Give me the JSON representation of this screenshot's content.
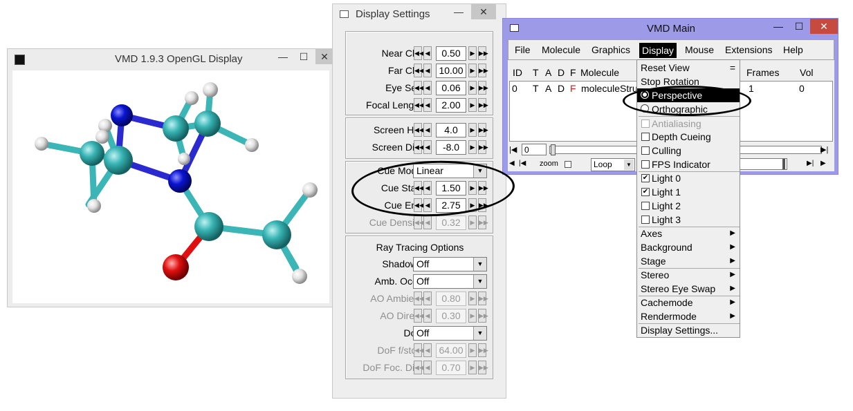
{
  "gl_window": {
    "title": "VMD 1.9.3 OpenGL Display",
    "app_icon": "vmd-app-icon",
    "controls": {
      "minimize": "—",
      "maximize": "☐",
      "close": "✕"
    }
  },
  "display_settings": {
    "title": "Display Settings",
    "controls": {
      "minimize": "—",
      "close": "✕"
    },
    "clip_group": [
      {
        "label": "Near Clip",
        "value": "0.50"
      },
      {
        "label": "Far Clip",
        "value": "10.00"
      },
      {
        "label": "Eye Sep",
        "value": "0.06"
      },
      {
        "label": "Focal Length",
        "value": "2.00"
      }
    ],
    "screen_group": [
      {
        "label": "Screen Hgt",
        "value": "4.0"
      },
      {
        "label": "Screen Dist",
        "value": "-8.0"
      }
    ],
    "cue_group": {
      "mode_label": "Cue Mode",
      "mode_value": "Linear",
      "rows": [
        {
          "label": "Cue Start",
          "value": "1.50",
          "disabled": false
        },
        {
          "label": "Cue End",
          "value": "2.75",
          "disabled": false
        },
        {
          "label": "Cue Density",
          "value": "0.32",
          "disabled": true
        }
      ]
    },
    "ray_group": {
      "heading": "Ray Tracing Options",
      "shadows_label": "Shadows",
      "shadows_value": "Off",
      "ao_label": "Amb. Occl.",
      "ao_value": "Off",
      "ao_rows": [
        {
          "label": "AO Ambient",
          "value": "0.80"
        },
        {
          "label": "AO Direct",
          "value": "0.30"
        }
      ],
      "dof_label": "DoF",
      "dof_value": "Off",
      "dof_rows": [
        {
          "label": "DoF f/stop",
          "value": "64.00"
        },
        {
          "label": "DoF Foc. Dist",
          "value": "0.70"
        }
      ]
    }
  },
  "vmd_main": {
    "title": "VMD Main",
    "controls": {
      "minimize": "—",
      "maximize": "☐",
      "close": "✕"
    },
    "menu": [
      "File",
      "Molecule",
      "Graphics",
      "Display",
      "Mouse",
      "Extensions",
      "Help"
    ],
    "active_menu": "Display",
    "columns": {
      "id": "ID",
      "t": "T",
      "a": "A",
      "d": "D",
      "f": "F",
      "molecule": "Molecule",
      "frames": "Frames",
      "vol": "Vol"
    },
    "row": {
      "id": "0",
      "t": "T",
      "a": "A",
      "d": "D",
      "f": "F",
      "molecule": "moleculeStru",
      "frames": "1",
      "vol": "0"
    },
    "frame_field": "0",
    "zoom_label": "zoom",
    "loop_value": "Loop",
    "accent_color": "#9d9ae7"
  },
  "display_menu": {
    "items": [
      {
        "label": "Reset View",
        "kind": "plain",
        "extra": "="
      },
      {
        "label": "Stop Rotation",
        "kind": "plain"
      },
      {
        "label": "Perspective",
        "kind": "radio",
        "checked": true,
        "highlighted": true
      },
      {
        "label": "Orthographic",
        "kind": "radio",
        "checked": false
      },
      {
        "label": "Antialiasing",
        "kind": "check",
        "checked": false,
        "disabled": true
      },
      {
        "label": "Depth Cueing",
        "kind": "check",
        "checked": false
      },
      {
        "label": "Culling",
        "kind": "check",
        "checked": false
      },
      {
        "label": "FPS Indicator",
        "kind": "check",
        "checked": false
      },
      {
        "label": "Light 0",
        "kind": "check",
        "checked": true
      },
      {
        "label": "Light 1",
        "kind": "check",
        "checked": true
      },
      {
        "label": "Light 2",
        "kind": "check",
        "checked": false
      },
      {
        "label": "Light 3",
        "kind": "check",
        "checked": false
      },
      {
        "label": "Axes",
        "kind": "submenu"
      },
      {
        "label": "Background",
        "kind": "submenu"
      },
      {
        "label": "Stage",
        "kind": "submenu"
      },
      {
        "label": "Stereo",
        "kind": "submenu"
      },
      {
        "label": "Stereo Eye Swap",
        "kind": "submenu"
      },
      {
        "label": "Cachemode",
        "kind": "submenu"
      },
      {
        "label": "Rendermode",
        "kind": "submenu"
      },
      {
        "label": "Display Settings...",
        "kind": "plain"
      }
    ]
  },
  "molecule_colors": {
    "carbon": "#2fa8a8",
    "nitrogen": "#0a14c8",
    "oxygen": "#e01010",
    "hydrogen": "#e8e8e8"
  }
}
